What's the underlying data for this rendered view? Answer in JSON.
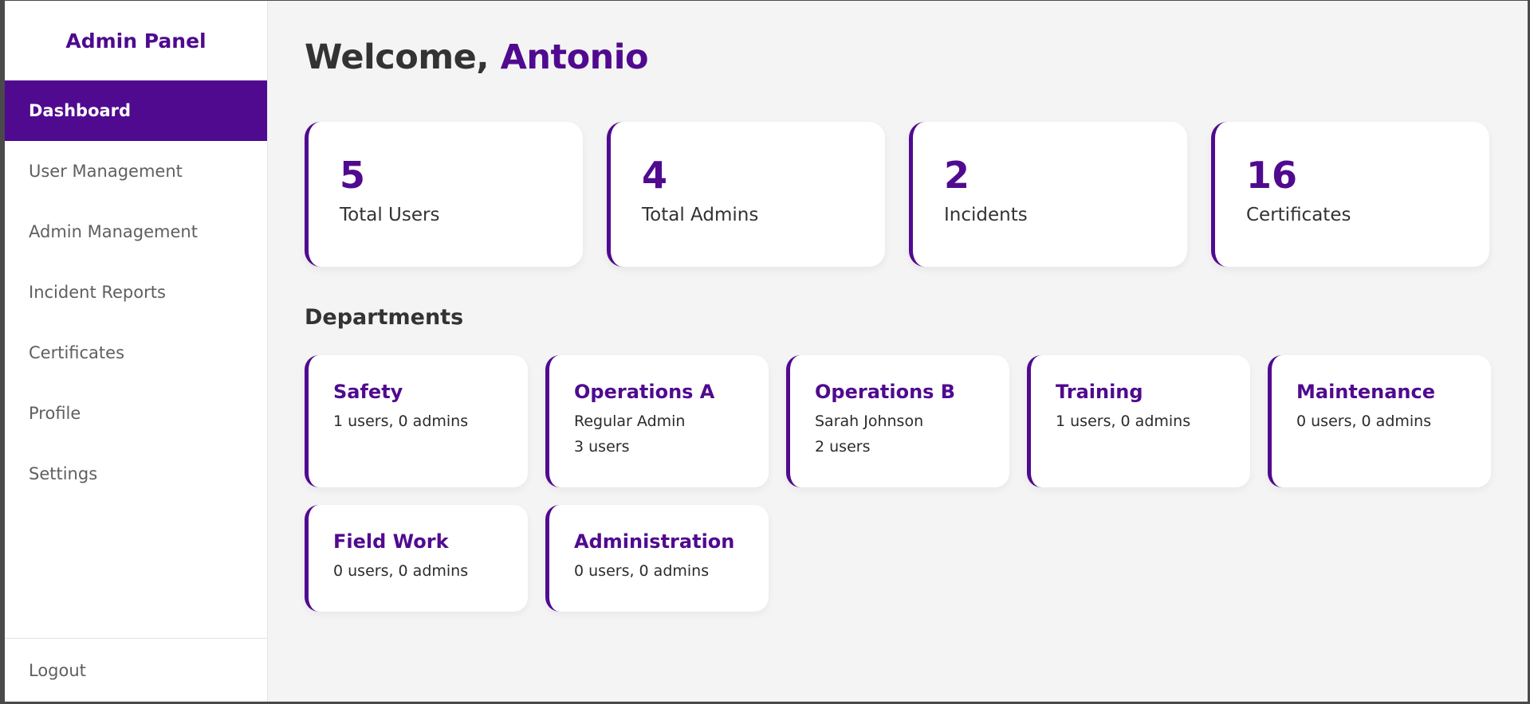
{
  "sidebar": {
    "brand": "Admin Panel",
    "items": [
      {
        "label": "Dashboard",
        "active": true
      },
      {
        "label": "User Management",
        "active": false
      },
      {
        "label": "Admin Management",
        "active": false
      },
      {
        "label": "Incident Reports",
        "active": false
      },
      {
        "label": "Certificates",
        "active": false
      },
      {
        "label": "Profile",
        "active": false
      },
      {
        "label": "Settings",
        "active": false
      }
    ],
    "logout": "Logout"
  },
  "main": {
    "welcome_prefix": "Welcome,",
    "user_name": "Antonio",
    "stats": [
      {
        "value": "5",
        "label": "Total Users"
      },
      {
        "value": "4",
        "label": "Total Admins"
      },
      {
        "value": "2",
        "label": "Incidents"
      },
      {
        "value": "16",
        "label": "Certificates"
      }
    ],
    "departments_title": "Departments",
    "departments": [
      {
        "name": "Safety",
        "line1": "1 users, 0 admins",
        "line2": ""
      },
      {
        "name": "Operations A",
        "line1": "Regular Admin",
        "line2": "3 users"
      },
      {
        "name": "Operations B",
        "line1": "Sarah Johnson",
        "line2": "2 users"
      },
      {
        "name": "Training",
        "line1": "1 users, 0 admins",
        "line2": ""
      },
      {
        "name": "Maintenance",
        "line1": "0 users, 0 admins",
        "line2": ""
      },
      {
        "name": "Field Work",
        "line1": "0 users, 0 admins",
        "line2": ""
      },
      {
        "name": "Administration",
        "line1": "0 users, 0 admins",
        "line2": ""
      }
    ]
  },
  "colors": {
    "accent": "#500a8f",
    "background": "#f4f4f4",
    "text": "#333333"
  }
}
